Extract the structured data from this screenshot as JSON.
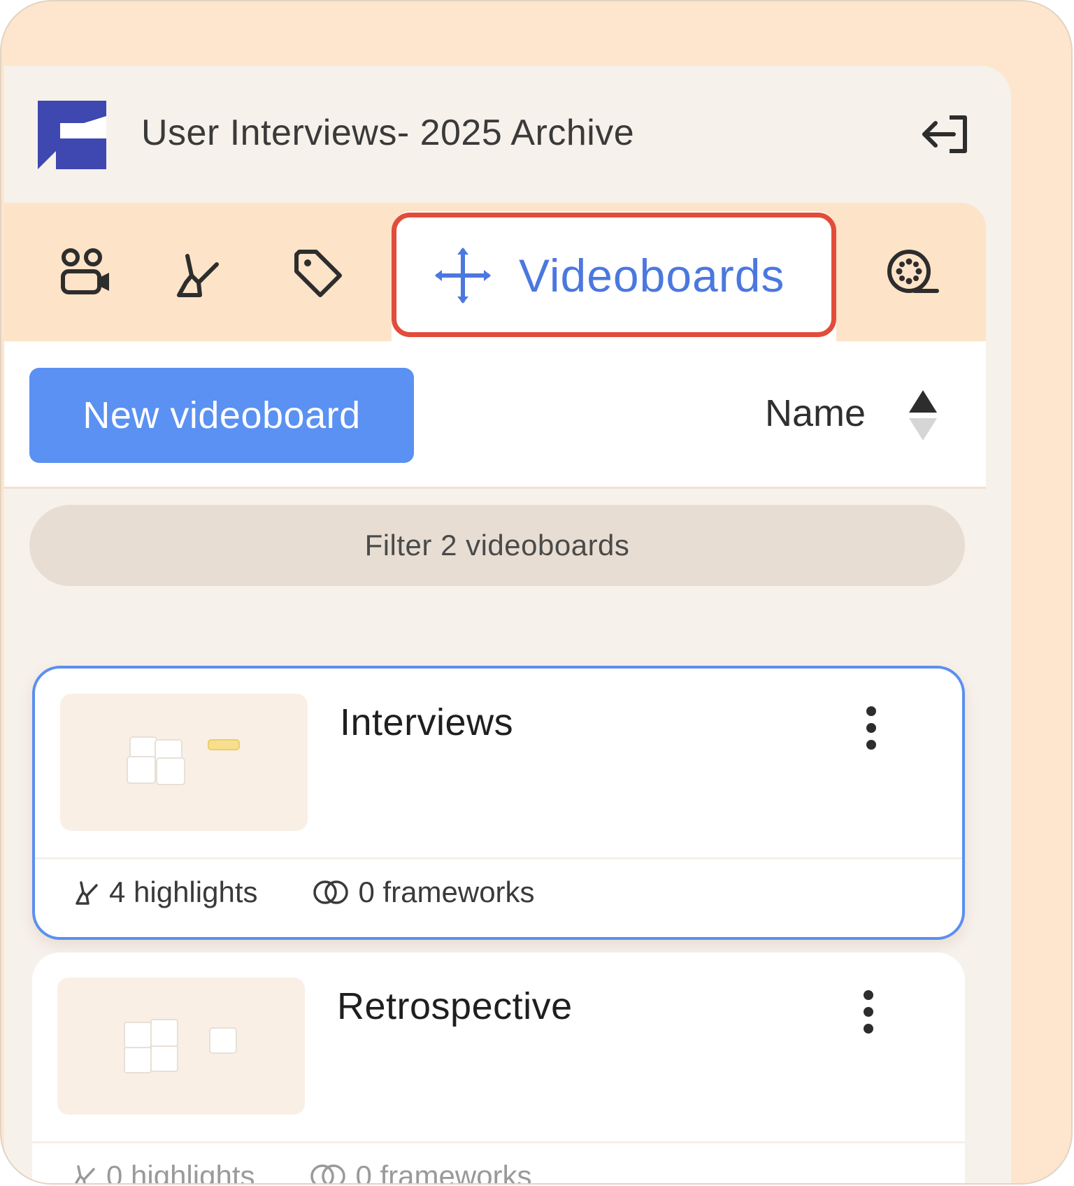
{
  "header": {
    "project_title": "User Interviews- 2025 Archive"
  },
  "tabs": [
    {
      "icon": "people-camera-icon"
    },
    {
      "icon": "highlighter-icon"
    },
    {
      "icon": "tag-icon"
    },
    {
      "icon": "videoboard-move-icon",
      "label": "Videoboards",
      "active": true
    },
    {
      "icon": "film-reel-icon"
    }
  ],
  "toolbar": {
    "new_button_label": "New videoboard",
    "sort_label": "Name"
  },
  "filter": {
    "label": "Filter 2 videoboards"
  },
  "videoboards": [
    {
      "title": "Interviews",
      "highlights": "4 highlights",
      "frameworks": "0 frameworks",
      "selected": true
    },
    {
      "title": "Retrospective",
      "highlights": "0 highlights",
      "frameworks": "0 frameworks",
      "selected": false
    }
  ],
  "colors": {
    "accent": "#5a91f2",
    "highlight_border": "#e24c3b",
    "active_tab_text": "#4b78df",
    "logo": "#3f47b0",
    "background": "#fde6cd"
  }
}
